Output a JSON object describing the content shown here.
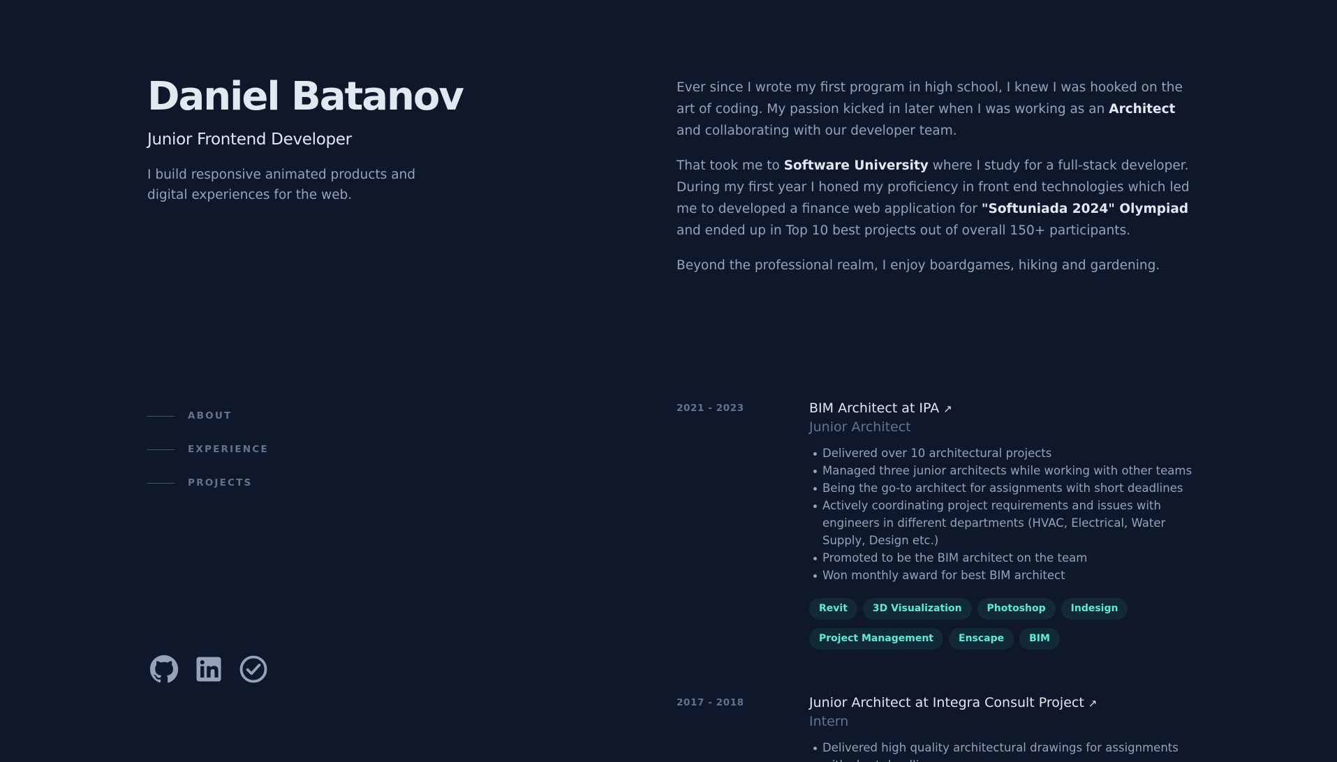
{
  "header": {
    "name": "Daniel Batanov",
    "role": "Junior Frontend Developer",
    "tagline": "I build responsive animated products and digital experiences for the web."
  },
  "nav": {
    "items": [
      {
        "label": "ABOUT"
      },
      {
        "label": "EXPERIENCE"
      },
      {
        "label": "PROJECTS"
      }
    ]
  },
  "socials": [
    {
      "icon": "github-icon"
    },
    {
      "icon": "linkedin-icon"
    },
    {
      "icon": "checkmark-circle-icon"
    }
  ],
  "about": {
    "p1": {
      "t1": "Ever since I wrote my first program in high school, I knew I was hooked on the art of coding. My passion kicked in later when I was working as an ",
      "h1": "Architect",
      "t2": " and collaborating with our developer team."
    },
    "p2": {
      "t1": "That took me to ",
      "h1": "Software University",
      "t2": " where I study for a full-stack developer. During my first year I honed my proficiency in front end technologies which led me to developed a finance web application for ",
      "h2": "\"Softuniada 2024\" Olympiad",
      "t3": " and ended up in Top 10 best projects out of overall 150+ participants."
    },
    "p3": "Beyond the professional realm, I enjoy boardgames, hiking and gardening."
  },
  "experience": [
    {
      "date": "2021 - 2023",
      "title": "BIM Architect at IPA",
      "subtitle": "Junior Architect",
      "bullets": [
        "Delivered over 10 architectural projects",
        "Managed three junior architects while working with other teams",
        "Being the go-to architect for assignments with short deadlines",
        "Actively coordinating project requirements and issues with engineers in different departments (HVAC, Electrical, Water Supply, Design etc.)",
        "Promoted to be the BIM architect on the team",
        "Won monthly award for best BIM architect"
      ],
      "tags": [
        "Revit",
        "3D Visualization",
        "Photoshop",
        "Indesign",
        "Project Management",
        "Enscape",
        "BIM"
      ]
    },
    {
      "date": "2017 - 2018",
      "title": "Junior Architect at Integra Consult Project",
      "subtitle": "Intern",
      "bullets": [
        "Delivered high quality architectural drawings for assignments with short deadlines"
      ]
    }
  ],
  "colors": {
    "background": "#0f172a",
    "heading": "#e2e8f0",
    "body": "#94a3b8",
    "muted": "#64748b",
    "accent": "#5eead4"
  }
}
